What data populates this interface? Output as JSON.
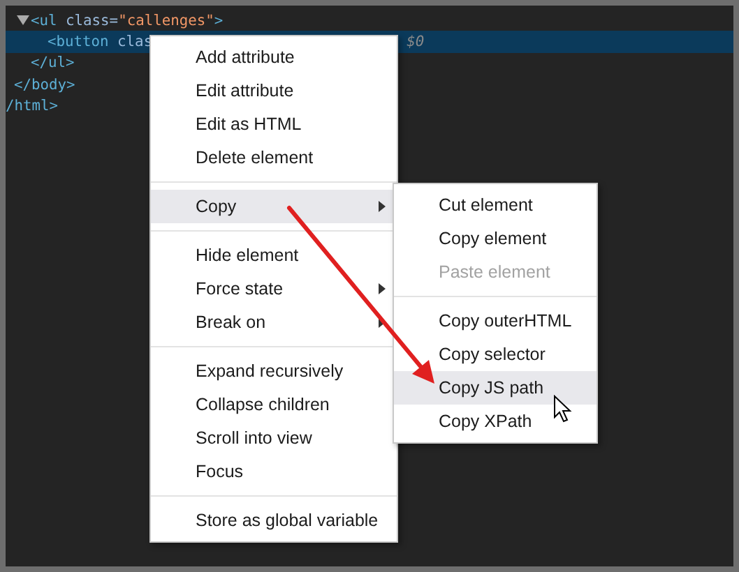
{
  "code_tree": [
    {
      "close": [
        {
          "kind": "tag",
          "text": "/html>"
        }
      ],
      "children": [
        {
          "close": [
            {
              "kind": "tag",
              "text": "</body>"
            }
          ],
          "children": [
            {
              "expanded": true,
              "selected": false,
              "open": [
                {
                  "kind": "tag",
                  "text": "<ul "
                },
                {
                  "kind": "attr",
                  "text": "class="
                },
                {
                  "kind": "value",
                  "text": "\"callenges\""
                },
                {
                  "kind": "tag",
                  "text": ">"
                }
              ],
              "close": [
                {
                  "kind": "tag",
                  "text": "</ul>"
                }
              ],
              "children": [
                {
                  "selected": true,
                  "open": [
                    {
                      "kind": "tag",
                      "text": "<button "
                    },
                    {
                      "kind": "attr",
                      "text": "clas"
                    }
                  ],
                  "note": "$0"
                }
              ]
            }
          ]
        }
      ]
    }
  ],
  "context_menu": {
    "groups": [
      [
        {
          "label": "Add attribute",
          "selected": false,
          "submenu": false
        },
        {
          "label": "Edit attribute",
          "selected": false,
          "submenu": false
        },
        {
          "label": "Edit as HTML",
          "selected": false,
          "submenu": false
        },
        {
          "label": "Delete element",
          "selected": false,
          "submenu": false
        }
      ],
      [
        {
          "label": "Copy",
          "selected": true,
          "submenu": true
        }
      ],
      [
        {
          "label": "Hide element",
          "selected": false,
          "submenu": false
        },
        {
          "label": "Force state",
          "selected": false,
          "submenu": true
        },
        {
          "label": "Break on",
          "selected": false,
          "submenu": true
        }
      ],
      [
        {
          "label": "Expand recursively",
          "selected": false,
          "submenu": false
        },
        {
          "label": "Collapse children",
          "selected": false,
          "submenu": false
        },
        {
          "label": "Scroll into view",
          "selected": false,
          "submenu": false
        },
        {
          "label": "Focus",
          "selected": false,
          "submenu": false
        }
      ],
      [
        {
          "label": "Store as global variable",
          "selected": false,
          "submenu": false
        }
      ]
    ]
  },
  "copy_submenu": {
    "groups": [
      [
        {
          "label": "Cut element",
          "selected": false,
          "disabled": false
        },
        {
          "label": "Copy element",
          "selected": false,
          "disabled": false
        },
        {
          "label": "Paste element",
          "selected": false,
          "disabled": true
        }
      ],
      [
        {
          "label": "Copy outerHTML",
          "selected": false,
          "disabled": false
        },
        {
          "label": "Copy selector",
          "selected": false,
          "disabled": false
        },
        {
          "label": "Copy JS path",
          "selected": true,
          "disabled": false
        },
        {
          "label": "Copy XPath",
          "selected": false,
          "disabled": false
        }
      ]
    ]
  }
}
